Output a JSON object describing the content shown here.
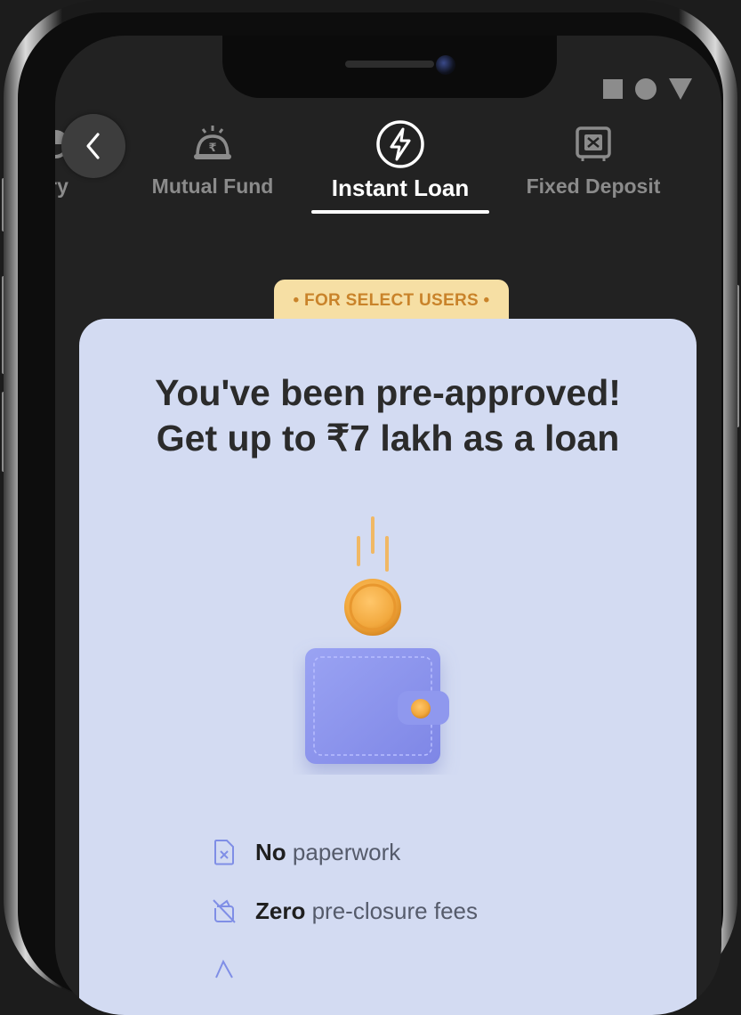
{
  "status_bar": {
    "icons": [
      "square-icon",
      "circle-icon",
      "triangle-icon"
    ]
  },
  "tabs": [
    {
      "label": "Summary",
      "icon": "pie-chart-icon",
      "active": false
    },
    {
      "label": "Mutual Fund",
      "icon": "rupee-pot-icon",
      "active": false
    },
    {
      "label": "Instant Loan",
      "icon": "lightning-icon",
      "active": true
    },
    {
      "label": "Fixed Deposit",
      "icon": "safe-icon",
      "active": false
    }
  ],
  "badge": {
    "text": "• FOR SELECT USERS •"
  },
  "card": {
    "headline_line1": "You've been pre-approved!",
    "headline_line2": "Get up to ₹7 lakh as a loan",
    "illustration": "wallet-with-coin-icon",
    "features": [
      {
        "bold": "No",
        "rest": "paperwork",
        "icon": "document-x-icon"
      },
      {
        "bold": "Zero",
        "rest": "pre-closure fees",
        "icon": "no-fee-icon"
      },
      {
        "bold": "",
        "rest": "",
        "icon": "partial-icon"
      }
    ]
  },
  "colors": {
    "screen_bg": "#222222",
    "card_bg": "#d3dbf2",
    "badge_bg": "#f6dfa4",
    "badge_text": "#c9832a",
    "active_tab": "#ffffff",
    "inactive_tab": "#8b8b8b",
    "wallet": "#8e97ea",
    "coin": "#f2a93e"
  }
}
